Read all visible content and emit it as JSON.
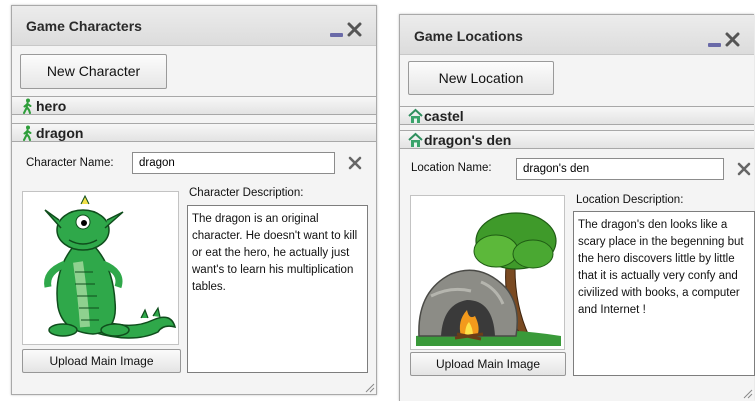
{
  "characters_panel": {
    "title": "Game Characters",
    "new_button_label": "New Character",
    "items": [
      {
        "label": "hero",
        "icon": "walking-person-icon"
      },
      {
        "label": "dragon",
        "icon": "walking-person-icon"
      }
    ],
    "form": {
      "name_label": "Character Name:",
      "name_value": "dragon",
      "description_label": "Character Description:",
      "description_text": "The dragon is an original character. He doesn't want to kill or eat the hero, he actually just want's to learn his multiplication tables.",
      "upload_label": "Upload Main Image",
      "image_icon": "green-dragon-illustration"
    }
  },
  "locations_panel": {
    "title": "Game Locations",
    "new_button_label": "New Location",
    "items": [
      {
        "label": "castel",
        "icon": "house-icon"
      },
      {
        "label": "dragon's den",
        "icon": "house-icon"
      }
    ],
    "form": {
      "name_label": "Location Name:",
      "name_value": "dragon's den",
      "description_label": "Location Description:",
      "description_text": "The dragon's den looks like a scary place in the begenning but the hero discovers little by little that it is actually very confy and civilized with books, a computer and Internet !",
      "upload_label": "Upload Main Image",
      "image_icon": "cave-with-tree-and-campfire-illustration"
    }
  },
  "colors": {
    "panel_bg": "#f4f4f4",
    "titlebar": "#dcdcdc",
    "minimize_icon": "#6a6aa8",
    "person_icon": "#2e9e3a",
    "house_icon": "#3aa36b",
    "dragon_green": "#2fa84a"
  }
}
